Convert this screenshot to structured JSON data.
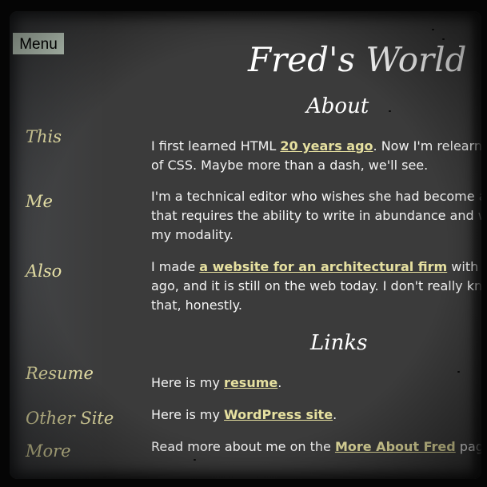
{
  "menu": {
    "label": "Menu"
  },
  "site": {
    "title": "Fred's World"
  },
  "about": {
    "title": "About",
    "rows": [
      {
        "label": "This",
        "lines": [
          {
            "before": "I first learned HTML ",
            "link": "20 years ago",
            "after": ". Now I'm relearnin"
          },
          {
            "before": "of CSS. Maybe more than a dash, we'll see.",
            "link": "",
            "after": ""
          }
        ]
      },
      {
        "label": "Me",
        "lines": [
          {
            "before": "I'm a technical editor who wishes she had become a",
            "link": "",
            "after": ""
          },
          {
            "before": "that requires the ability to write in abundance and w",
            "link": "",
            "after": ""
          },
          {
            "before": "my modality.",
            "link": "",
            "after": ""
          }
        ]
      },
      {
        "label": "Also",
        "lines": [
          {
            "before": "I made ",
            "link": "a website for an architectural firm",
            "after": " with Dre"
          },
          {
            "before": "ago, and it is still on the web today. I don't really kno",
            "link": "",
            "after": ""
          },
          {
            "before": "that, honestly.",
            "link": "",
            "after": ""
          }
        ]
      }
    ]
  },
  "links": {
    "title": "Links",
    "rows": [
      {
        "label": "Resume",
        "before": "Here is my ",
        "link": "resume",
        "after": "."
      },
      {
        "label": "Other Site",
        "before": "Here is my ",
        "link": "WordPress site",
        "after": "."
      },
      {
        "label": "More",
        "before": "Read more about me on the ",
        "link": "More About Fred",
        "after": " pag"
      }
    ]
  },
  "colors": {
    "background": "#3b3b3b",
    "link": "#e6e0a0",
    "side_label": "#e8e2a8",
    "menu_button": "#d4e4d4"
  }
}
